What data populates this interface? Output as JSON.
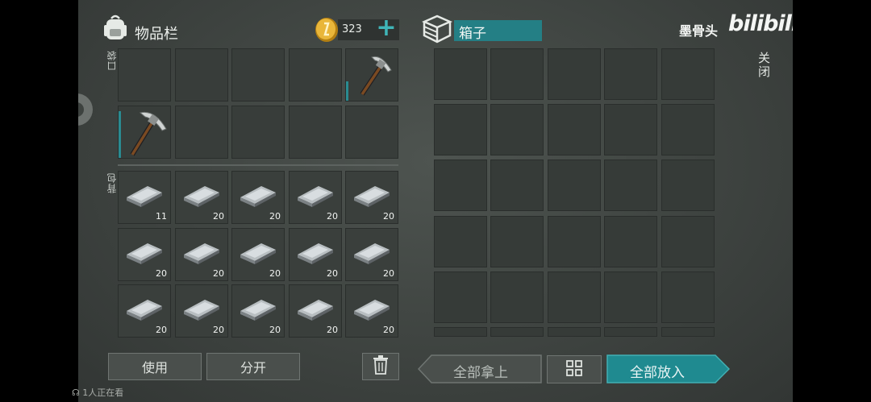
{
  "inventory": {
    "title": "物品栏",
    "coins": "323",
    "add_label": "+",
    "pocket_label": "口袋",
    "backpack_label": "背包",
    "pocket": [
      {
        "item": "",
        "count": ""
      },
      {
        "item": "",
        "count": ""
      },
      {
        "item": "",
        "count": ""
      },
      {
        "item": "",
        "count": ""
      },
      {
        "item": "pickaxe-icon",
        "count": ""
      },
      {
        "item": "pickaxe-icon",
        "count": ""
      },
      {
        "item": "",
        "count": ""
      },
      {
        "item": "",
        "count": ""
      },
      {
        "item": "",
        "count": ""
      },
      {
        "item": "",
        "count": ""
      }
    ],
    "backpack": [
      {
        "item": "iron-ingot-icon",
        "count": "11"
      },
      {
        "item": "iron-ingot-icon",
        "count": "20"
      },
      {
        "item": "iron-ingot-icon",
        "count": "20"
      },
      {
        "item": "iron-ingot-icon",
        "count": "20"
      },
      {
        "item": "iron-ingot-icon",
        "count": "20"
      },
      {
        "item": "iron-ingot-icon",
        "count": "20"
      },
      {
        "item": "iron-ingot-icon",
        "count": "20"
      },
      {
        "item": "iron-ingot-icon",
        "count": "20"
      },
      {
        "item": "iron-ingot-icon",
        "count": "20"
      },
      {
        "item": "iron-ingot-icon",
        "count": "20"
      },
      {
        "item": "iron-ingot-icon",
        "count": "20"
      },
      {
        "item": "iron-ingot-icon",
        "count": "20"
      },
      {
        "item": "iron-ingot-icon",
        "count": "20"
      },
      {
        "item": "iron-ingot-icon",
        "count": "20"
      },
      {
        "item": "iron-ingot-icon",
        "count": "20"
      }
    ],
    "use_label": "使用",
    "split_label": "分开"
  },
  "box": {
    "title": "箱子",
    "close_label": "关闭",
    "take_all_label": "全部拿上",
    "put_all_label": "全部放入"
  },
  "watermark": {
    "author": "墨骨头",
    "brand": "bilibili"
  },
  "viewers": "1人正在看",
  "colors": {
    "accent_teal": "#1d8f95",
    "teal_light": "#3fa9ad",
    "coin_gold": "#d9a52a"
  }
}
